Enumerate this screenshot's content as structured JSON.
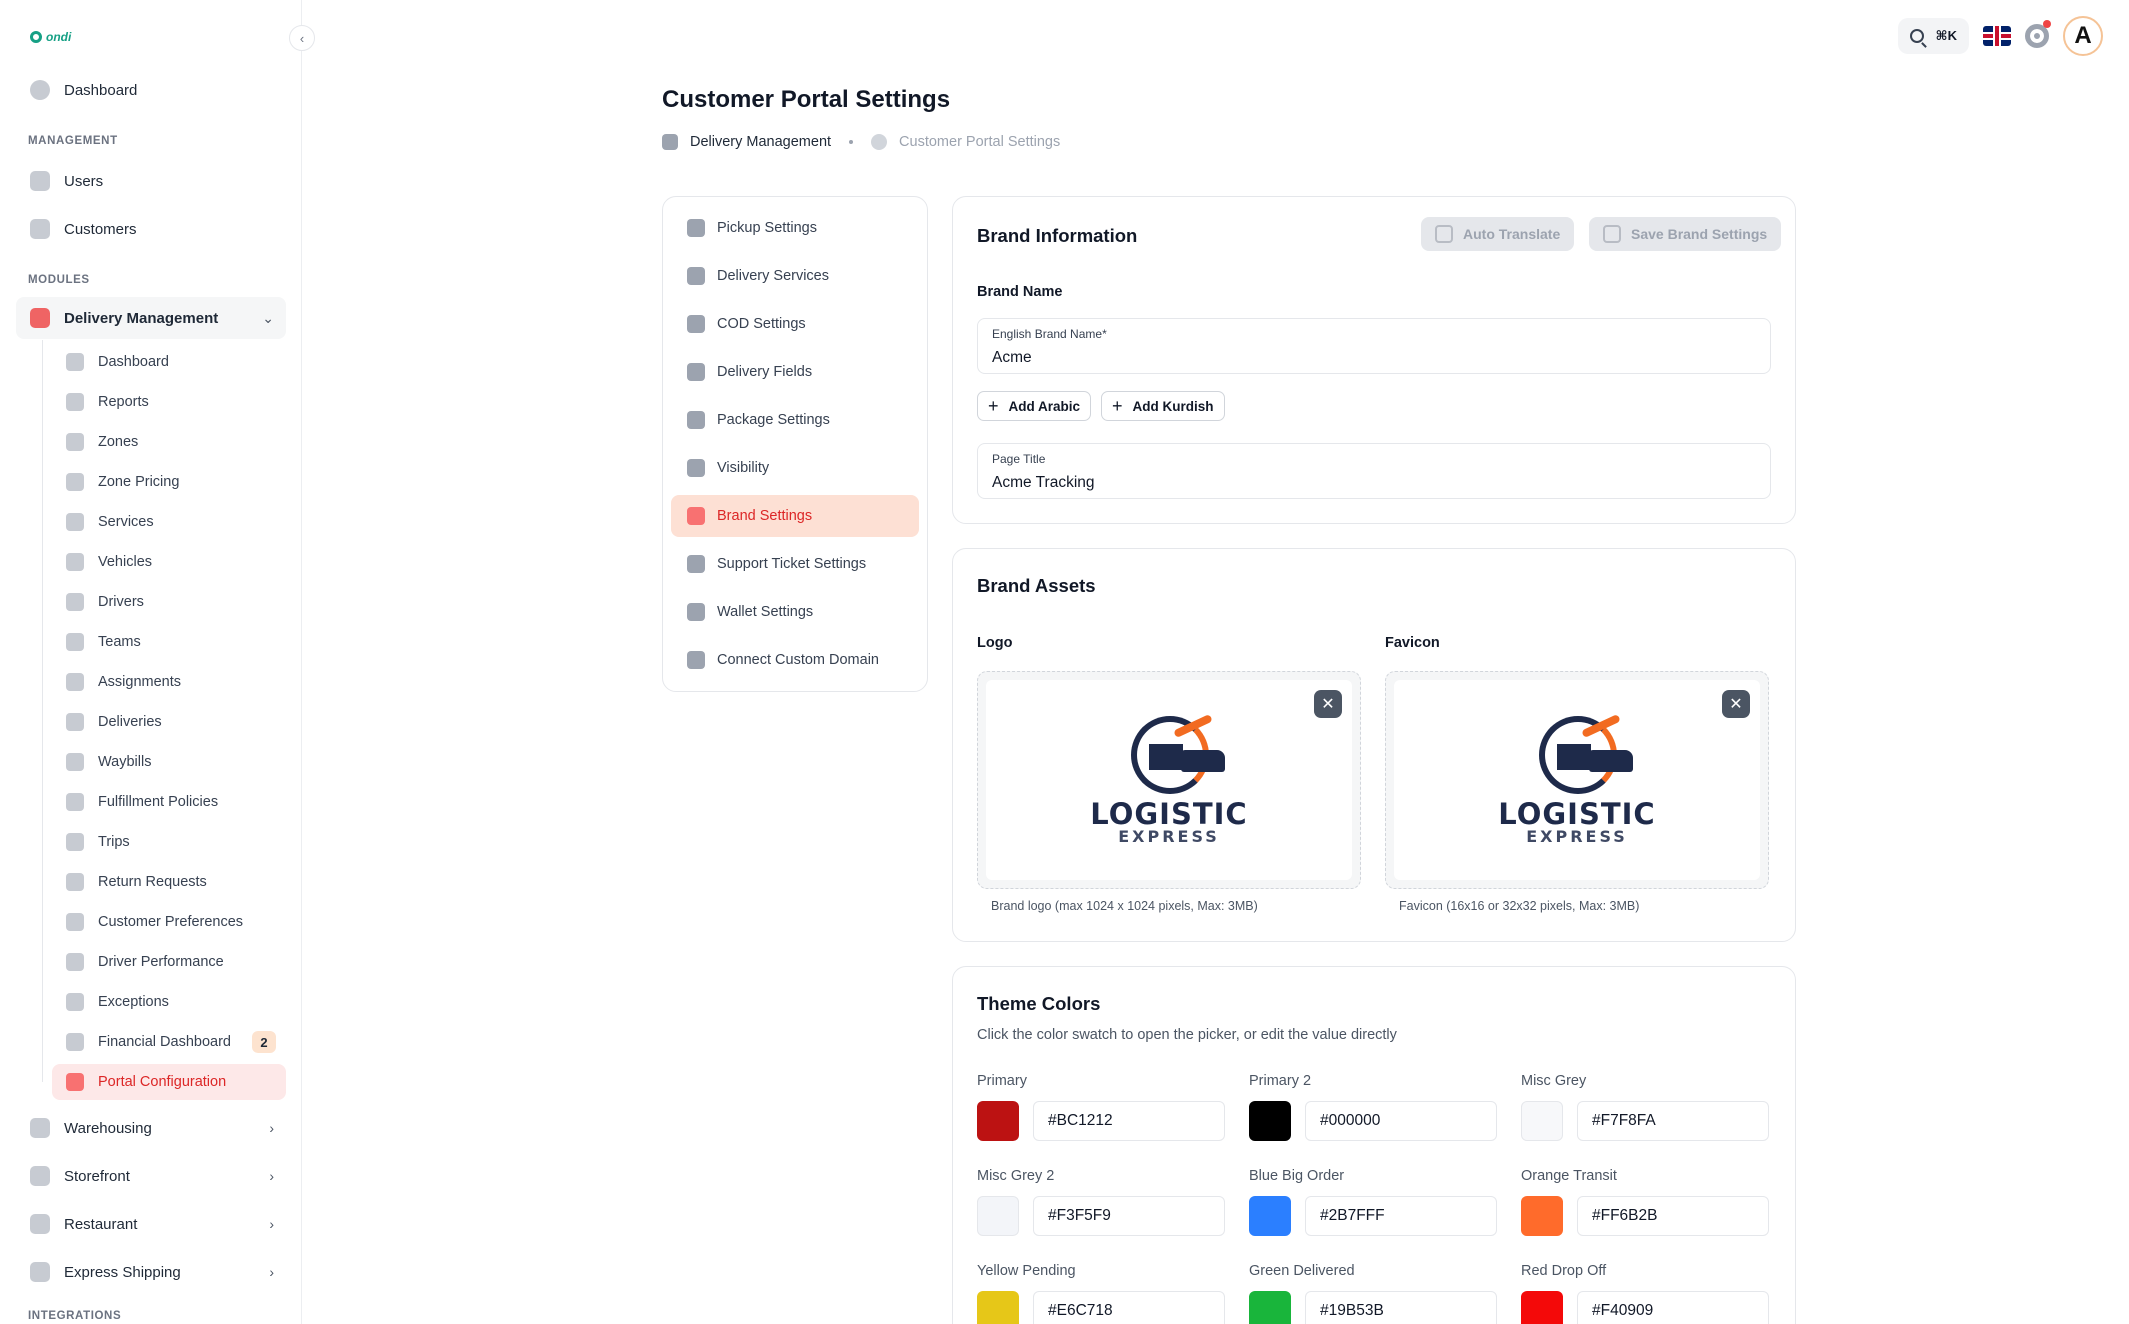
{
  "app": {
    "logo_text": "ondi"
  },
  "topbar": {
    "shortcut": "⌘K",
    "avatar_letter": "A"
  },
  "sidebar": {
    "dashboard": "Dashboard",
    "management_label": "MANAGEMENT",
    "users": "Users",
    "customers": "Customers",
    "modules_label": "MODULES",
    "delivery_management": "Delivery Management",
    "sub_items": [
      "Dashboard",
      "Reports",
      "Zones",
      "Zone Pricing",
      "Services",
      "Vehicles",
      "Drivers",
      "Teams",
      "Assignments",
      "Deliveries",
      "Waybills",
      "Fulfillment Policies",
      "Trips",
      "Return Requests",
      "Customer Preferences",
      "Driver Performance",
      "Exceptions",
      "Financial Dashboard",
      "Portal Configuration"
    ],
    "financial_badge": "2",
    "warehousing": "Warehousing",
    "storefront": "Storefront",
    "restaurant": "Restaurant",
    "express_shipping": "Express Shipping",
    "integrations_label": "INTEGRATIONS"
  },
  "page": {
    "title": "Customer Portal Settings",
    "breadcrumb": [
      "Delivery Management",
      "Customer Portal Settings"
    ]
  },
  "settings_menu": [
    "Pickup Settings",
    "Delivery Services",
    "COD Settings",
    "Delivery Fields",
    "Package Settings",
    "Visibility",
    "Brand Settings",
    "Support Ticket Settings",
    "Wallet Settings",
    "Connect Custom Domain"
  ],
  "brand_info": {
    "title": "Brand Information",
    "auto_translate": "Auto Translate",
    "save": "Save Brand Settings",
    "brand_name_label": "Brand Name",
    "english_label": "English Brand Name",
    "required_mark": "*",
    "english_value": "Acme",
    "add_arabic": "Add Arabic",
    "add_kurdish": "Add Kurdish",
    "page_title_label": "Page Title",
    "page_title_value": "Acme Tracking"
  },
  "brand_assets": {
    "title": "Brand Assets",
    "logo_label": "Logo",
    "favicon_label": "Favicon",
    "logo_word": "LOGISTIC",
    "logo_sub": "EXPRESS",
    "logo_hint": "Brand logo (max 1024 x 1024 pixels, Max: 3MB)",
    "favicon_hint": "Favicon (16x16 or 32x32 pixels, Max: 3MB)"
  },
  "theme_colors": {
    "title": "Theme Colors",
    "subtitle": "Click the color swatch to open the picker, or edit the value directly",
    "colors": [
      {
        "label": "Primary",
        "hex": "#BC1212"
      },
      {
        "label": "Primary 2",
        "hex": "#000000"
      },
      {
        "label": "Misc Grey",
        "hex": "#F7F8FA"
      },
      {
        "label": "Misc Grey 2",
        "hex": "#F3F5F9"
      },
      {
        "label": "Blue Big Order",
        "hex": "#2B7FFF"
      },
      {
        "label": "Orange Transit",
        "hex": "#FF6B2B"
      },
      {
        "label": "Yellow Pending",
        "hex": "#E6C718"
      },
      {
        "label": "Green Delivered",
        "hex": "#19B53B"
      },
      {
        "label": "Red Drop Off",
        "hex": "#F40909"
      }
    ]
  }
}
